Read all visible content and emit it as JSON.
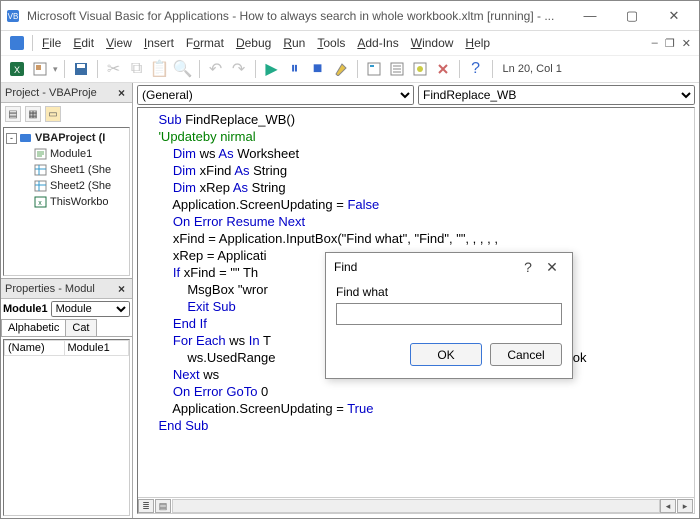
{
  "titlebar": {
    "title": "Microsoft Visual Basic for Applications - How to always search in whole workbook.xltm [running] - ..."
  },
  "menu": {
    "items": [
      "File",
      "Edit",
      "View",
      "Insert",
      "Format",
      "Debug",
      "Run",
      "Tools",
      "Add-Ins",
      "Window",
      "Help"
    ]
  },
  "toolbar": {
    "status": "Ln 20, Col 1"
  },
  "project": {
    "title": "Project - VBAProje",
    "root": "VBAProject (I",
    "items": [
      "Module1",
      "Sheet1 (She",
      "Sheet2 (She",
      "ThisWorkbo"
    ]
  },
  "properties": {
    "title": "Properties - Modul",
    "object_name": "Module1",
    "object_type_option": "Module",
    "tabs": [
      "Alphabetic",
      "Cat"
    ],
    "rows": [
      {
        "k": "(Name)",
        "v": "Module1"
      }
    ]
  },
  "code_combo": {
    "left_option": "(General)",
    "right_option": "FindReplace_WB"
  },
  "code": {
    "l1a": "Sub",
    "l1b": " FindReplace_WB()",
    "l2": "'Updateby nirmal",
    "l3a": "Dim",
    "l3b": " ws ",
    "l3c": "As",
    "l3d": " Worksheet",
    "l4a": "Dim",
    "l4b": " xFind ",
    "l4c": "As",
    "l4d": " String",
    "l5a": "Dim",
    "l5b": " xRep ",
    "l5c": "As",
    "l5d": " String",
    "l6a": "Application.ScreenUpdating = ",
    "l6b": "False",
    "l7": "On Error Resume Next",
    "l8": "xFind = Application.InputBox(\"Find what\", \"Find\", \"\", , , , ,",
    "l9": "xRep = Applicati",
    "l10a": "If",
    "l10b": " xFind = \"\" Th",
    "l11": "MsgBox \"wror",
    "l12": "Exit Sub",
    "l13": "End If",
    "l14a": "For Each",
    "l14b": " ws ",
    "l14c": "In",
    "l14d": " T",
    "l15": "ws.UsedRange",
    "l15tail": ":=xRep, Look",
    "l16a": "Next",
    "l16b": " ws",
    "l17": "On Error GoTo",
    "l17b": " 0",
    "l18a": "Application.ScreenUpdating = ",
    "l18b": "True",
    "l19": "End Sub"
  },
  "code_indent": {
    "p1": "    ",
    "p2": "        ",
    "p3": "            "
  },
  "dialog": {
    "title": "Find",
    "label": "Find what",
    "value": "",
    "ok": "OK",
    "cancel": "Cancel"
  }
}
